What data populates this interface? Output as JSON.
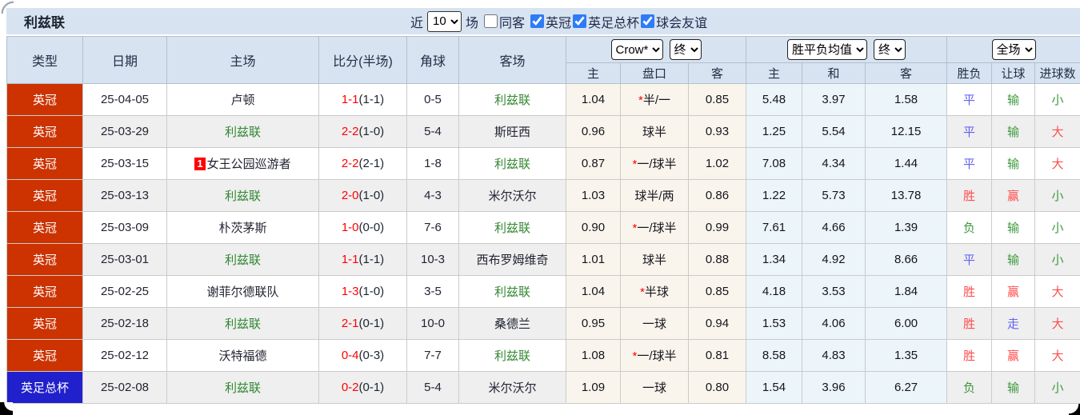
{
  "title": "利兹联",
  "controls": {
    "recent_label": "近",
    "recent_value": "10",
    "matches_label": "场",
    "same_venue": {
      "label": "同客",
      "checked": false
    },
    "leagues": [
      {
        "label": "英冠",
        "checked": true
      },
      {
        "label": "英足总杯",
        "checked": true
      },
      {
        "label": "球会友谊",
        "checked": true
      }
    ]
  },
  "table": {
    "columns": [
      "类型",
      "日期",
      "主场",
      "比分(半场)",
      "角球",
      "客场"
    ],
    "sub_columns": [
      "主",
      "盘口",
      "客",
      "主",
      "和",
      "客",
      "胜负",
      "让球",
      "进球数"
    ],
    "dropdowns": {
      "bookmaker": "Crow*",
      "bookmaker_state": "终",
      "average": "胜平负均值",
      "average_state": "终",
      "scope": "全场"
    },
    "rows": [
      {
        "league": "英冠",
        "league_style": "championship",
        "date": "25-04-05",
        "rank": "",
        "home": "卢顿",
        "score": "1-1",
        "half": "(1-1)",
        "corners": "0-5",
        "away": "利兹联",
        "odds_home": "1.04",
        "handicap": "*半/一",
        "odds_away": "0.85",
        "avg_home": "5.48",
        "avg_draw": "3.97",
        "avg_away": "1.58",
        "result": "平",
        "handicap_result": "输",
        "goals": "小"
      },
      {
        "league": "英冠",
        "league_style": "championship",
        "date": "25-03-29",
        "rank": "",
        "home": "利兹联",
        "score": "2-2",
        "half": "(1-0)",
        "corners": "5-4",
        "away": "斯旺西",
        "odds_home": "0.96",
        "handicap": "球半",
        "odds_away": "0.93",
        "avg_home": "1.25",
        "avg_draw": "5.54",
        "avg_away": "12.15",
        "result": "平",
        "handicap_result": "输",
        "goals": "大"
      },
      {
        "league": "英冠",
        "league_style": "championship",
        "date": "25-03-15",
        "rank": "1",
        "home": "女王公园巡游者",
        "score": "2-2",
        "half": "(2-1)",
        "corners": "1-8",
        "away": "利兹联",
        "odds_home": "0.87",
        "handicap": "*一/球半",
        "odds_away": "1.02",
        "avg_home": "7.08",
        "avg_draw": "4.34",
        "avg_away": "1.44",
        "result": "平",
        "handicap_result": "输",
        "goals": "大"
      },
      {
        "league": "英冠",
        "league_style": "championship",
        "date": "25-03-13",
        "rank": "",
        "home": "利兹联",
        "score": "2-0",
        "half": "(1-0)",
        "corners": "4-3",
        "away": "米尔沃尔",
        "odds_home": "1.03",
        "handicap": "球半/两",
        "odds_away": "0.86",
        "avg_home": "1.22",
        "avg_draw": "5.73",
        "avg_away": "13.78",
        "result": "胜",
        "handicap_result": "赢",
        "goals": "小"
      },
      {
        "league": "英冠",
        "league_style": "championship",
        "date": "25-03-09",
        "rank": "",
        "home": "朴茨茅斯",
        "score": "1-0",
        "half": "(0-0)",
        "corners": "7-6",
        "away": "利兹联",
        "odds_home": "0.90",
        "handicap": "*一/球半",
        "odds_away": "0.99",
        "avg_home": "7.61",
        "avg_draw": "4.66",
        "avg_away": "1.39",
        "result": "负",
        "handicap_result": "输",
        "goals": "小"
      },
      {
        "league": "英冠",
        "league_style": "championship",
        "date": "25-03-01",
        "rank": "",
        "home": "利兹联",
        "score": "1-1",
        "half": "(1-1)",
        "corners": "10-3",
        "away": "西布罗姆维奇",
        "odds_home": "1.01",
        "handicap": "球半",
        "odds_away": "0.88",
        "avg_home": "1.34",
        "avg_draw": "4.92",
        "avg_away": "8.66",
        "result": "平",
        "handicap_result": "输",
        "goals": "小"
      },
      {
        "league": "英冠",
        "league_style": "championship",
        "date": "25-02-25",
        "rank": "",
        "home": "谢菲尔德联队",
        "score": "1-3",
        "half": "(1-0)",
        "corners": "3-5",
        "away": "利兹联",
        "odds_home": "1.04",
        "handicap": "*半球",
        "odds_away": "0.85",
        "avg_home": "4.18",
        "avg_draw": "3.53",
        "avg_away": "1.84",
        "result": "胜",
        "handicap_result": "赢",
        "goals": "大"
      },
      {
        "league": "英冠",
        "league_style": "championship",
        "date": "25-02-18",
        "rank": "",
        "home": "利兹联",
        "score": "2-1",
        "half": "(0-1)",
        "corners": "10-0",
        "away": "桑德兰",
        "odds_home": "0.95",
        "handicap": "一球",
        "odds_away": "0.94",
        "avg_home": "1.53",
        "avg_draw": "4.06",
        "avg_away": "6.00",
        "result": "胜",
        "handicap_result": "走",
        "goals": "大"
      },
      {
        "league": "英冠",
        "league_style": "championship",
        "date": "25-02-12",
        "rank": "",
        "home": "沃特福德",
        "score": "0-4",
        "half": "(0-3)",
        "corners": "7-7",
        "away": "利兹联",
        "odds_home": "1.08",
        "handicap": "*一/球半",
        "odds_away": "0.81",
        "avg_home": "8.58",
        "avg_draw": "4.83",
        "avg_away": "1.35",
        "result": "胜",
        "handicap_result": "赢",
        "goals": "大"
      },
      {
        "league": "英足总杯",
        "league_style": "facup",
        "date": "25-02-08",
        "rank": "",
        "home": "利兹联",
        "score": "0-2",
        "half": "(0-1)",
        "corners": "5-4",
        "away": "米尔沃尔",
        "odds_home": "1.09",
        "handicap": "一球",
        "odds_away": "0.80",
        "avg_home": "1.54",
        "avg_draw": "3.96",
        "avg_away": "6.27",
        "result": "负",
        "handicap_result": "输",
        "goals": "小"
      }
    ]
  },
  "colors": {
    "header_bg": "#d7e3f0",
    "league_championship": "#cc3300",
    "league_facup": "#2020cc",
    "team_highlight": "#338833",
    "score_red": "#ff0000",
    "result_win_red": "#ff4d4d",
    "result_lose_green": "#3c9a3c",
    "result_draw_blue": "#6262f6",
    "odds_col_bg": "#faf5ec",
    "avg_col_bg": "#ecf5f9",
    "row_alt_bg": "#efefef",
    "checkbox_blue": "#2e7bf6"
  }
}
